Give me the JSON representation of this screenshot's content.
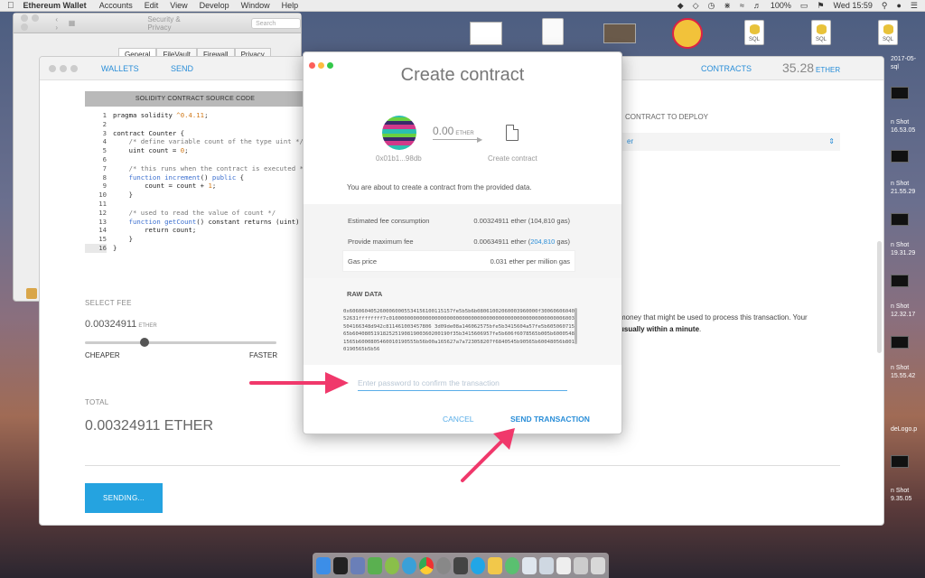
{
  "menubar": {
    "app": "Ethereum Wallet",
    "items": [
      "Accounts",
      "Edit",
      "View",
      "Develop",
      "Window",
      "Help"
    ],
    "battery": "100%",
    "clock": "Wed 15:59"
  },
  "desktop": {
    "sql_label": "SQL",
    "side_labels": [
      "2017-05-",
      "sql",
      "n Shot",
      "16.53.05",
      "n Shot",
      "21.55.29",
      "n Shot",
      "19.31.29",
      "n Shot",
      "12.32.17",
      "n Shot",
      "15.55.42",
      "deLogo.p",
      "n Shot",
      "9.35.05"
    ]
  },
  "security_window": {
    "title": "Security & Privacy",
    "search_placeholder": "Search",
    "tabs": [
      "General",
      "FileVault",
      "Firewall",
      "Privacy"
    ]
  },
  "wallet": {
    "nav": {
      "wallets": "WALLETS",
      "send": "SEND",
      "contracts": "CONTRACTS"
    },
    "balance": "35.28",
    "balance_unit": "ETHER",
    "source_header": "SOLIDITY CONTRACT SOURCE CODE",
    "code_line_numbers": [
      "1",
      "2",
      "3",
      "4",
      "5",
      "6",
      "7",
      "8",
      "9",
      "10",
      "11",
      "12",
      "13",
      "14",
      "15",
      "16"
    ],
    "select_fee_label": "SELECT FEE",
    "fee_value": "0.00324911",
    "fee_unit": "ETHER",
    "cheaper": "CHEAPER",
    "faster": "FASTER",
    "total_label": "TOTAL",
    "total_value": "0.00324911 ETHER",
    "sending_button": "SENDING...",
    "contract_to_deploy": "CONTRACT TO DEPLOY",
    "contract_selected": "er",
    "desc_line1": "money that might be used to process this transaction. Your",
    "desc_line2": "usually within a minute",
    "desc_dot": "."
  },
  "modal": {
    "title": "Create contract",
    "from_address": "0x01b1...98db",
    "amount": "0.00",
    "amount_unit": "ETHER",
    "to_label": "Create contract",
    "about_text": "You are about to create a contract from the provided data.",
    "rows": [
      {
        "label": "Estimated fee consumption",
        "value": "0.00324911 ether (104,810 gas)"
      },
      {
        "label": "Provide maximum fee",
        "value_pre": "0.00634911 ether (",
        "value_link": "204,810",
        "value_post": " gas)"
      },
      {
        "label": "Gas price",
        "value": "0.031 ether per million gas"
      }
    ],
    "raw_label": "RAW DATA",
    "raw_data": "0x6060604052600060005534156100115157fe5b5b6b08061002060003960000f3006060604052631ffffffff7c0100000000000000000000000000000000000000000000000000000006003504166348d942c811461003457806 3d09de08a146062575bfe5b3415604a57fe5b60506071565b60408051918252519081900360200190f35b3415606957fe5b606f6078565b005b60005481565b6000805460010190555b56b00a165627a7a723058207f6840545b90565b60048056b8010190565b5b56",
    "password_placeholder": "Enter password to confirm the transaction",
    "cancel": "CANCEL",
    "send": "SEND TRANSACTION"
  },
  "colors": {
    "accent": "#2a8ed8",
    "button": "#25a3e0",
    "annotation_arrow": "#f0386b"
  }
}
